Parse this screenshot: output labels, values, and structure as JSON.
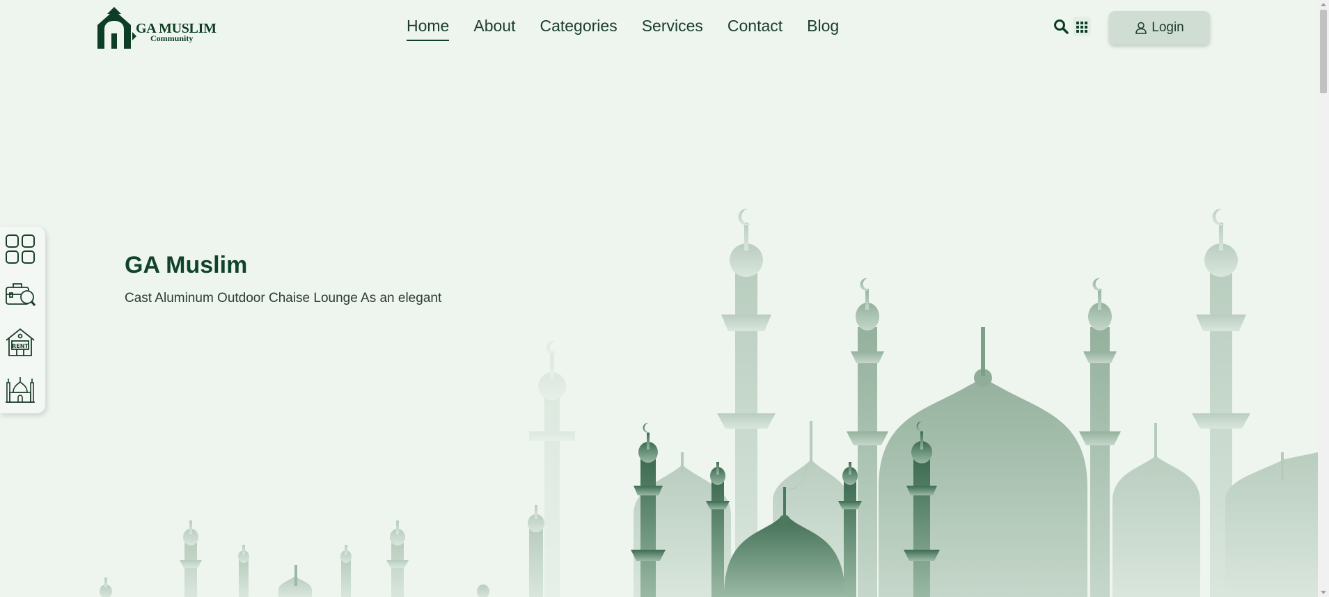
{
  "brand": {
    "title": "GA MUSLIM",
    "subtitle": "Community",
    "color": "#0d3d24"
  },
  "nav": {
    "items": [
      {
        "label": "Home",
        "active": true
      },
      {
        "label": "About",
        "active": false
      },
      {
        "label": "Categories",
        "active": false
      },
      {
        "label": "Services",
        "active": false
      },
      {
        "label": "Contact",
        "active": false
      },
      {
        "label": "Blog",
        "active": false
      }
    ]
  },
  "header": {
    "search_icon": "search-icon",
    "apps_icon": "grid-icon",
    "login_label": "Login",
    "login_icon": "user-icon"
  },
  "side_dock": {
    "items": [
      {
        "icon": "dashboard-icon"
      },
      {
        "icon": "briefcase-search-icon"
      },
      {
        "icon": "house-rent-icon"
      },
      {
        "icon": "mosque-icon"
      }
    ]
  },
  "hero": {
    "title": "GA Muslim",
    "subtitle": "Cast Aluminum Outdoor Chaise Lounge As an elegant"
  },
  "colors": {
    "background": "#eef5ef",
    "accent": "#0d3d24",
    "login_bg": "#cfddd3"
  }
}
